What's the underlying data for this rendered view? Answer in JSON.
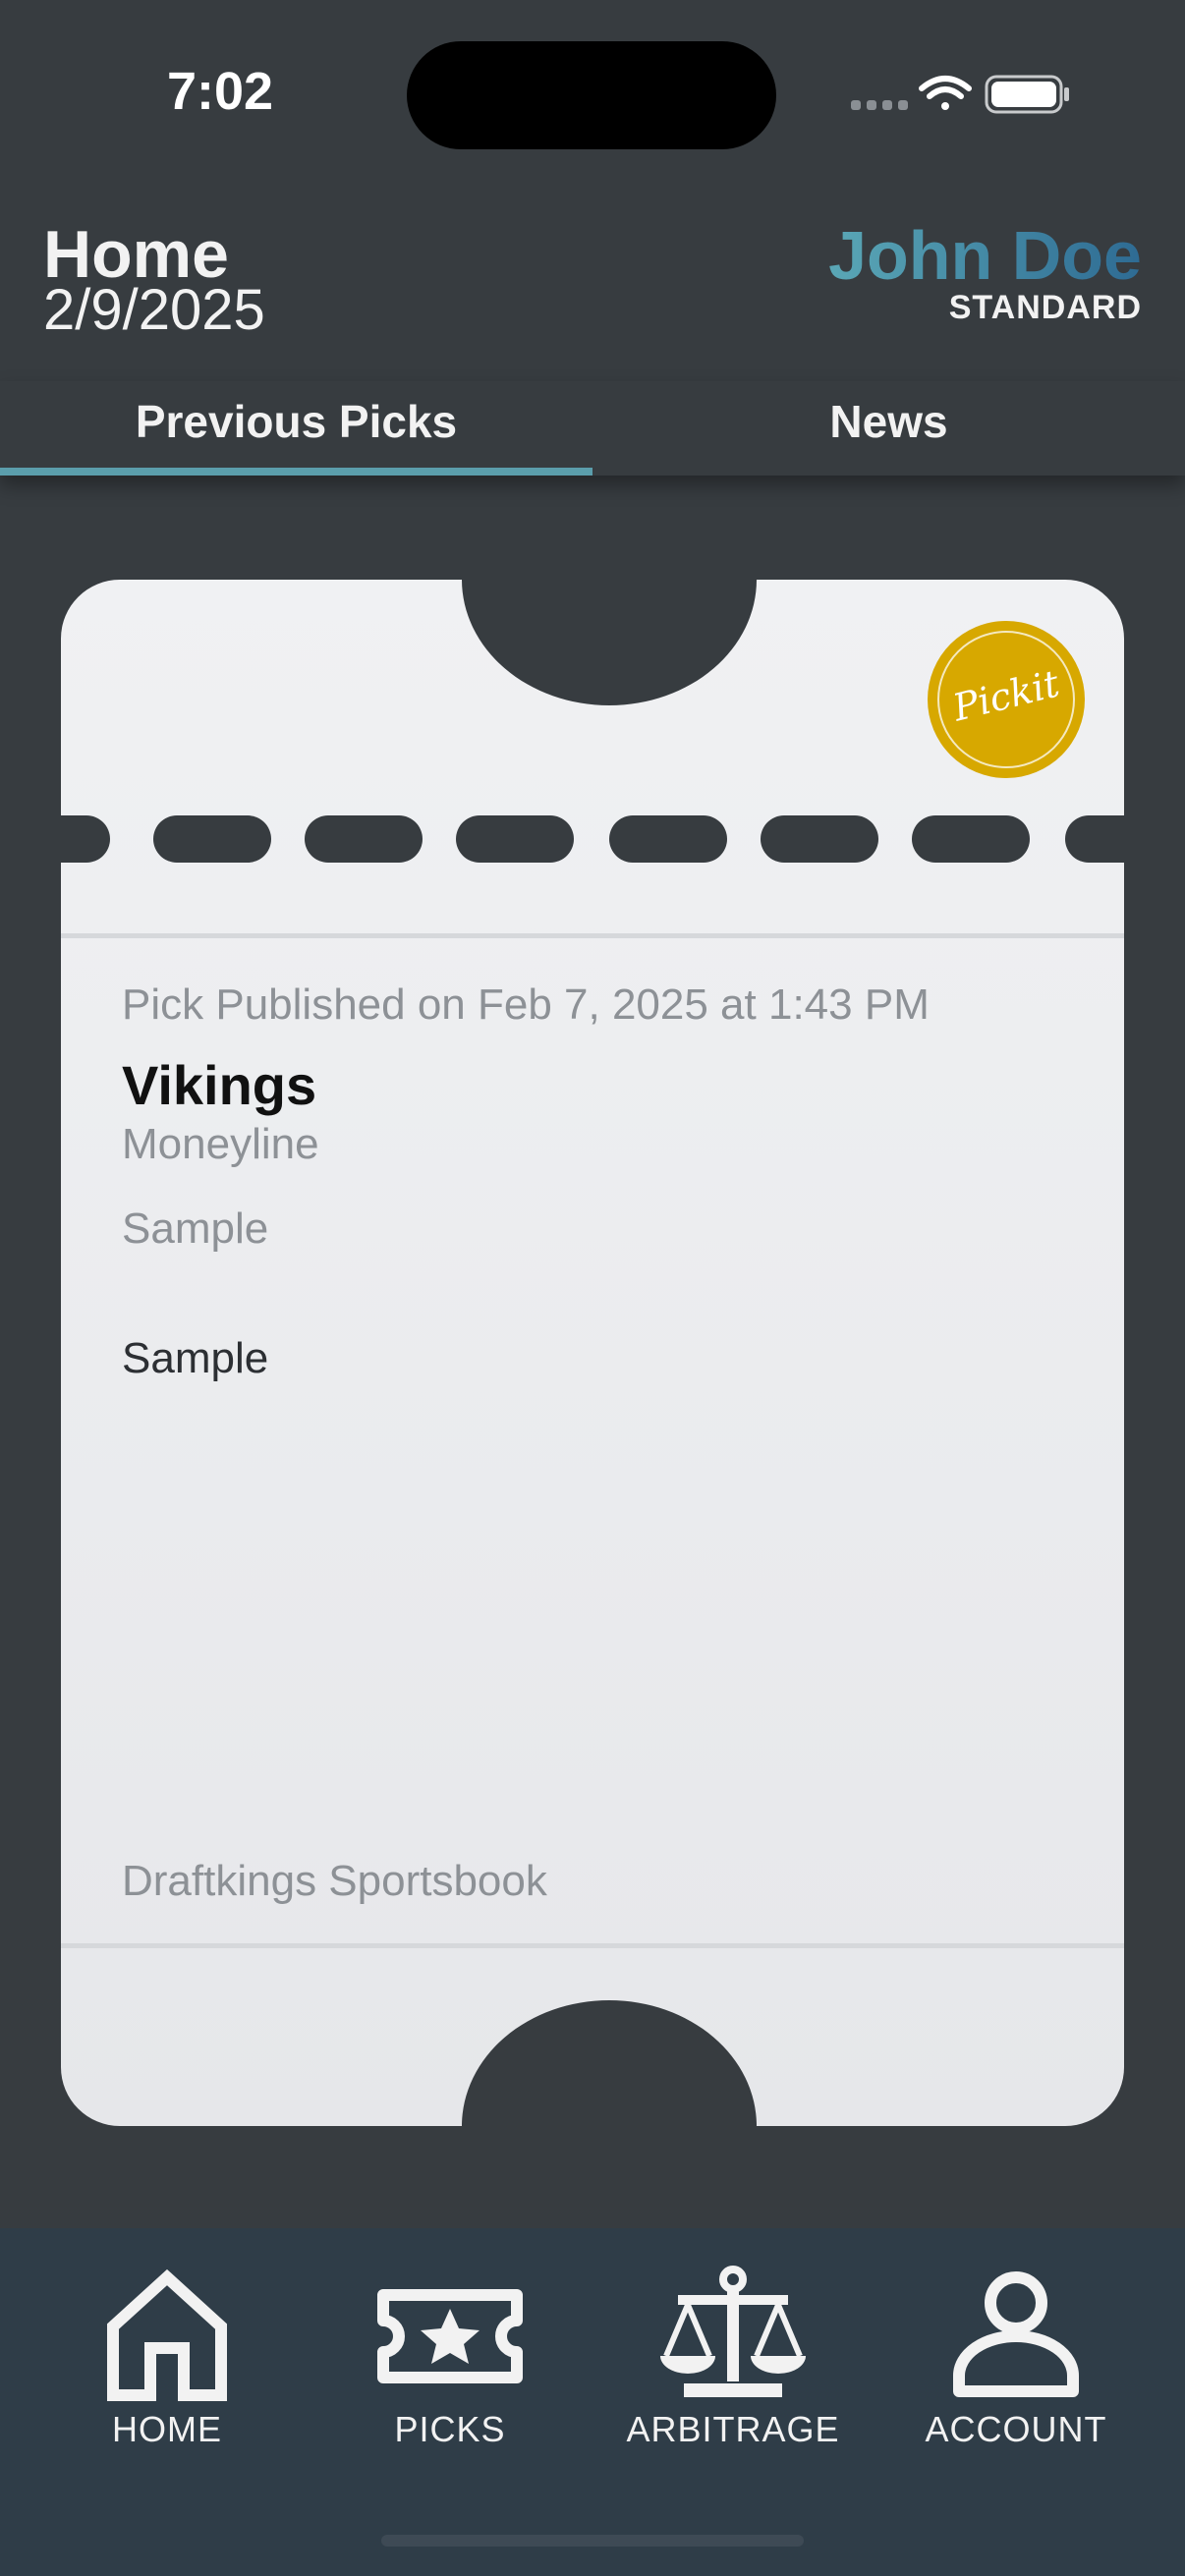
{
  "status_bar": {
    "time": "7:02"
  },
  "header": {
    "title": "Home",
    "date": "2/9/2025",
    "user_name": "John Doe",
    "user_tier": "STANDARD"
  },
  "tabs": [
    {
      "label": "Previous Picks",
      "active": true
    },
    {
      "label": "News",
      "active": false
    }
  ],
  "pick_card": {
    "logo_text": "Pickit",
    "published": "Pick Published on Feb 7, 2025 at 1:43 PM",
    "team": "Vikings",
    "bet_type": "Moneyline",
    "sample_1": "Sample",
    "sample_2": "Sample",
    "sportsbook": "Draftkings Sportsbook"
  },
  "bottom_nav": [
    {
      "label": "HOME",
      "icon": "home-icon"
    },
    {
      "label": "PICKS",
      "icon": "ticket-star-icon"
    },
    {
      "label": "ARBITRAGE",
      "icon": "scale-icon"
    },
    {
      "label": "ACCOUNT",
      "icon": "person-icon"
    }
  ],
  "colors": {
    "background": "#373c40",
    "accent": "#5b9eac",
    "card": "#e9eaed",
    "badge": "#d7a800",
    "nav_background": "#2f3d48"
  }
}
